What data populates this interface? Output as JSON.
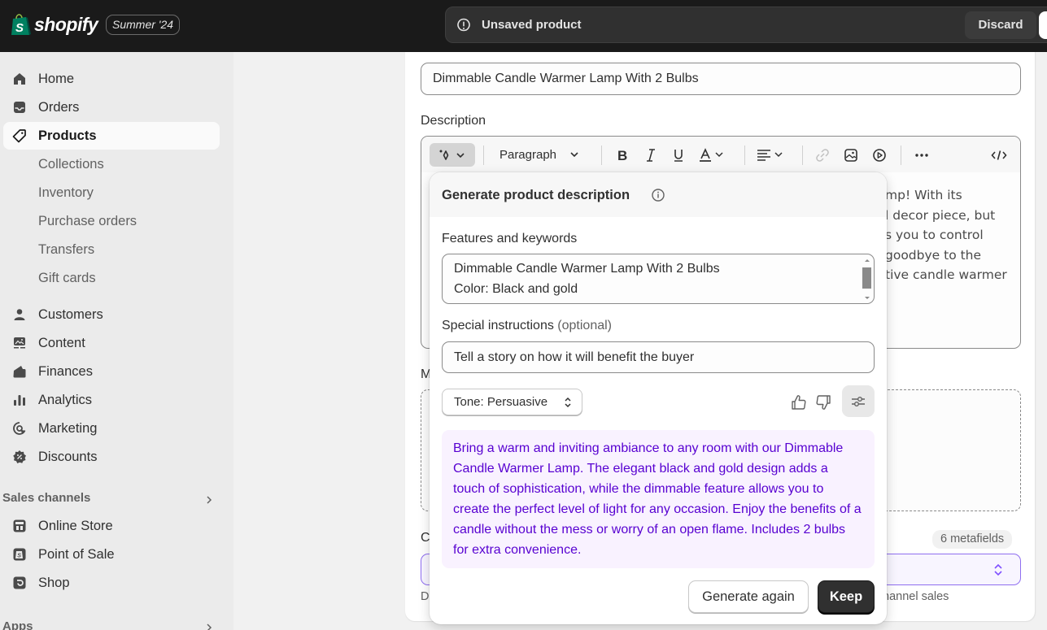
{
  "topbar": {
    "brand": "shopify",
    "edition": "Summer '24",
    "unsaved_message": "Unsaved product",
    "discard_label": "Discard"
  },
  "sidebar": {
    "items": [
      {
        "label": "Home",
        "icon": "home-icon"
      },
      {
        "label": "Orders",
        "icon": "orders-icon"
      },
      {
        "label": "Products",
        "icon": "tag-icon",
        "active": true
      },
      {
        "label": "Collections",
        "sub": true
      },
      {
        "label": "Inventory",
        "sub": true
      },
      {
        "label": "Purchase orders",
        "sub": true
      },
      {
        "label": "Transfers",
        "sub": true
      },
      {
        "label": "Gift cards",
        "sub": true
      },
      {
        "label": "Customers",
        "icon": "person-icon"
      },
      {
        "label": "Content",
        "icon": "content-icon"
      },
      {
        "label": "Finances",
        "icon": "wallet-icon"
      },
      {
        "label": "Analytics",
        "icon": "bar-chart-icon"
      },
      {
        "label": "Marketing",
        "icon": "target-icon"
      },
      {
        "label": "Discounts",
        "icon": "discount-icon"
      }
    ],
    "sales_channels_title": "Sales channels",
    "channels": [
      {
        "label": "Online Store",
        "icon": "store-icon"
      },
      {
        "label": "Point of Sale",
        "icon": "pos-icon"
      },
      {
        "label": "Shop",
        "icon": "shop-icon"
      }
    ],
    "apps_title": "Apps"
  },
  "product": {
    "title_value": "Dimmable Candle Warmer Lamp With 2 Bulbs",
    "description_label": "Description",
    "toolbar": {
      "paragraph_label": "Paragraph"
    },
    "description_visible_lines": [
      "mp! With its",
      "l decor piece, but",
      "s you to control",
      "goodbye to the",
      "tive candle warmer"
    ],
    "media_label": "M",
    "category_label": "C",
    "metafields_badge": "6 metafields",
    "category_help_start": "D",
    "category_help_tail": "hannel sales"
  },
  "generate_popover": {
    "title": "Generate product description",
    "features_label": "Features and keywords",
    "features_lines": [
      "Dimmable Candle Warmer Lamp With 2 Bulbs",
      "Color: Black and gold"
    ],
    "special_label": "Special instructions",
    "special_optional": "(optional)",
    "special_value": "Tell a story on how it will benefit the buyer",
    "tone_label": "Tone: Persuasive",
    "result_text": "Bring a warm and inviting ambiance to any room with our Dimmable Candle Warmer Lamp. The elegant black and gold design adds a touch of sophistication, while the dimmable feature allows you to create the perfect level of light for any occasion. Enjoy the benefits of a candle without the mess or worry of an open flame. Includes 2 bulbs for extra convenience.",
    "generate_again_label": "Generate again",
    "keep_label": "Keep"
  },
  "colors": {
    "topbar_bg": "#1a1a1a",
    "sidebar_bg": "#ebebeb",
    "ai_text": "#5700d1",
    "ai_bg": "#f9f2ff",
    "brand_green": "#008060"
  }
}
